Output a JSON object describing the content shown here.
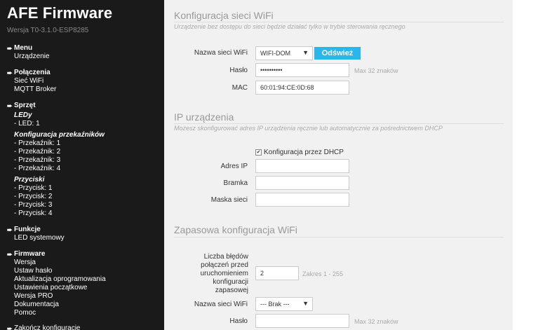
{
  "sidebar": {
    "brand": "AFE Firmware",
    "version": "Wersja T0-3.1.0-ESP8285",
    "sections": [
      {
        "title": "Menu",
        "links": [
          "Urządzenie"
        ]
      },
      {
        "title": "Połączenia",
        "links": [
          "Sieć WiFi",
          "MQTT Broker"
        ]
      },
      {
        "title": "Sprzęt",
        "groups": [
          {
            "name": "LEDy",
            "items": [
              "- LED: 1"
            ]
          },
          {
            "name": "Konfiguracja przekaźników",
            "items": [
              "- Przekaźnik: 1",
              "- Przekaźnik: 2",
              "- Przekaźnik: 3",
              "- Przekaźnik: 4"
            ]
          },
          {
            "name": "Przyciski",
            "items": [
              "- Przycisk: 1",
              "- Przycisk: 2",
              "- Przycisk: 3",
              "- Przycisk: 4"
            ]
          }
        ]
      },
      {
        "title": "Funkcje",
        "links": [
          "LED systemowy"
        ]
      },
      {
        "title": "Firmware",
        "links": [
          "Wersja",
          "Ustaw hasło",
          "Aktualizacja oprogramowania",
          "Ustawienia początkowe",
          "Wersja PRO",
          "Dokumentacja",
          "Pomoc"
        ]
      }
    ],
    "footer_partial": "Zakończ konfigurację"
  },
  "wifi": {
    "title": "Konfiguracja sieci WiFi",
    "description": "Urządzenie bez dostępu do sieci będzie działać tylko w trybie sterowania ręcznego",
    "ssid_label": "Nazwa sieci WiFi",
    "ssid_value": "WIFI-DOM",
    "refresh_label": "Odśwież",
    "password_label": "Hasło",
    "password_value": "••••••••••",
    "password_hint": "Max 32 znaków",
    "mac_label": "MAC",
    "mac_value": "60:01:94:CE:0D:68"
  },
  "ip": {
    "title": "IP urządzenia",
    "description": "Możesz skonfigurować adres IP urządzenia ręcznie lub automatycznie za pośrednictwem DHCP",
    "dhcp_label": "Konfiguracja przez DHCP",
    "dhcp_checked": true,
    "address_label": "Adres IP",
    "gateway_label": "Bramka",
    "mask_label": "Maska sieci"
  },
  "backup": {
    "title": "Zapasowa konfiguracja WiFi",
    "errors_label": [
      "Liczba błędów",
      "połączeń przed",
      "uruchomieniem",
      "konfiguracji",
      "zapasowej"
    ],
    "errors_value": "2",
    "errors_hint": "Zakres 1 - 255",
    "ssid_label": "Nazwa sieci WiFi",
    "ssid_value": "--- Brak ---",
    "password_label": "Hasło",
    "password_hint": "Max 32 znaków"
  },
  "icons": {
    "nav_arrow": "arrow-right-icon",
    "select_caret": "caret-down-icon",
    "check": "checkmark-icon"
  },
  "colors": {
    "sidebar_bg": "#1a1a1a",
    "content_bg": "#f1f1f1",
    "button_bg": "#2bb5e8"
  }
}
